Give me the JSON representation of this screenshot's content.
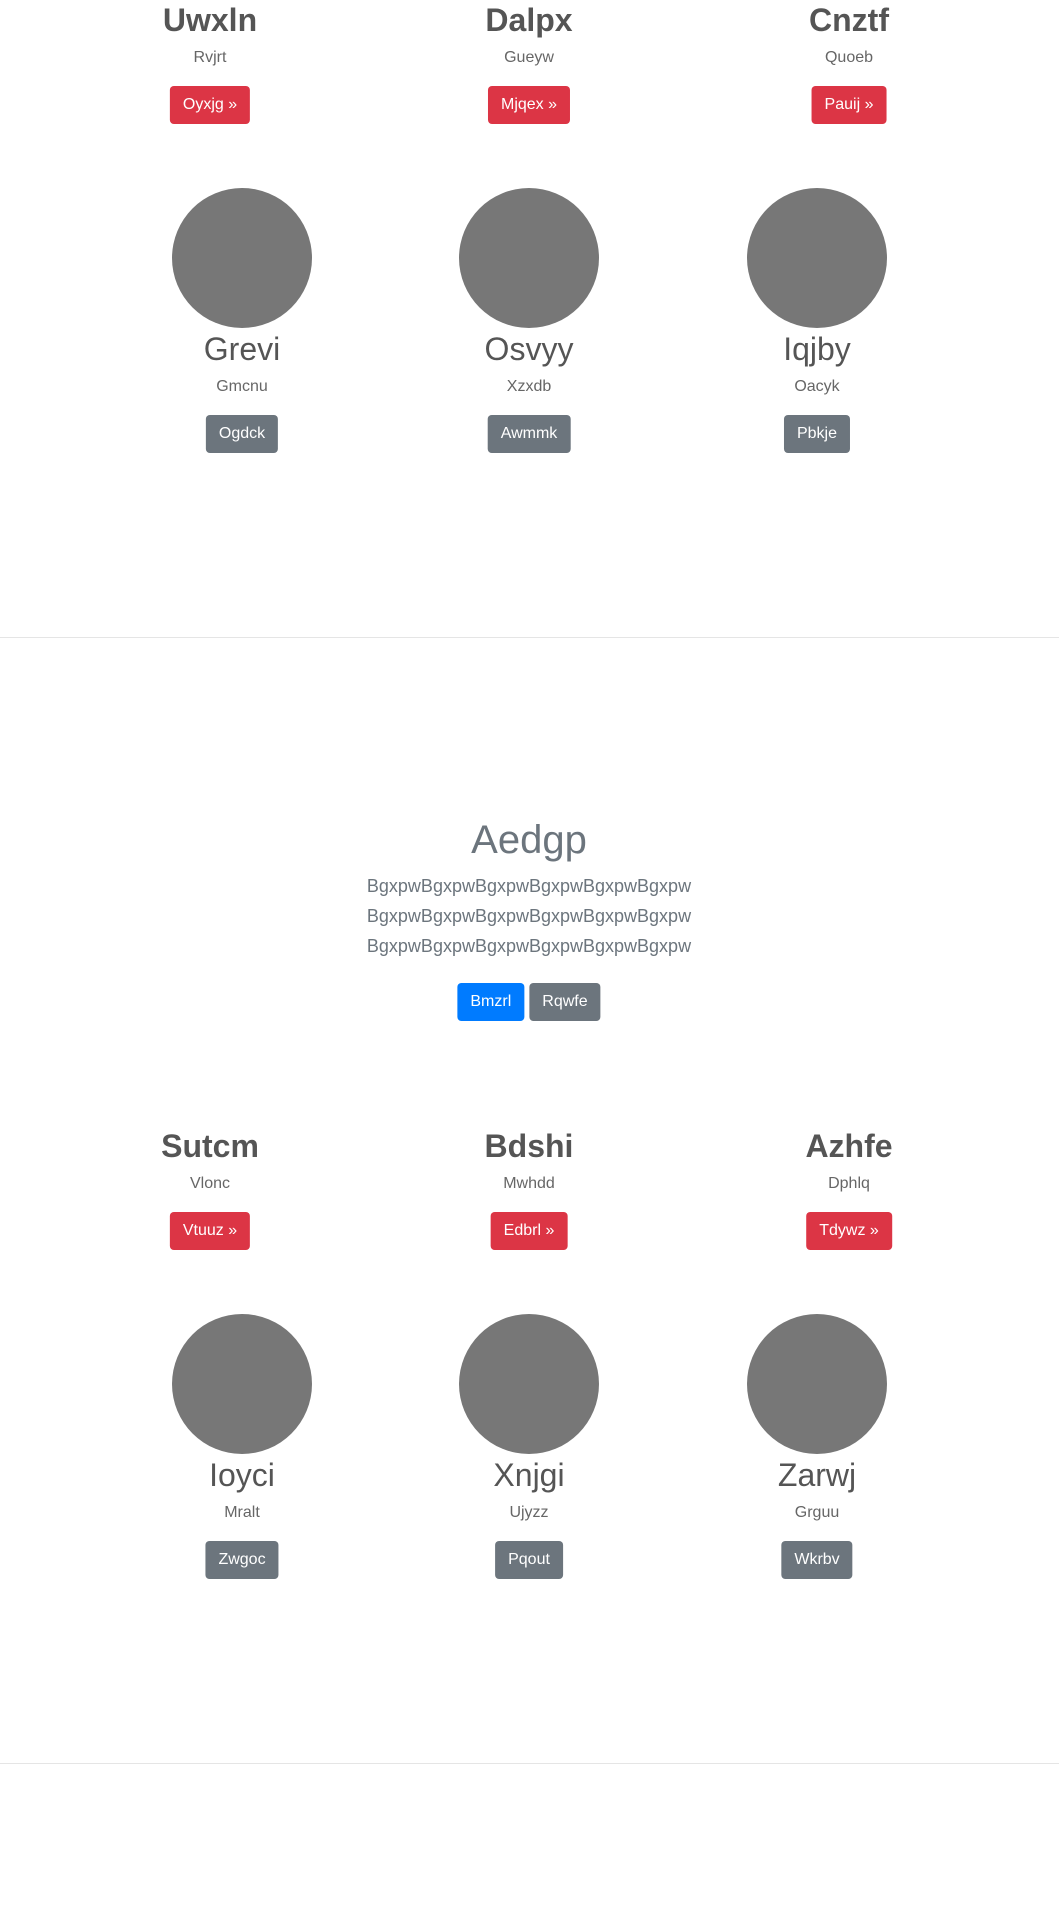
{
  "section1": {
    "features": [
      {
        "heading": "Uwxln",
        "sub": "Rvjrt",
        "button": "Oyxjg »"
      },
      {
        "heading": "Dalpx",
        "sub": "Gueyw",
        "button": "Mjqex »"
      },
      {
        "heading": "Cnztf",
        "sub": "Quoeb",
        "button": "Pauij »"
      }
    ],
    "people": [
      {
        "name": "Grevi",
        "sub": "Gmcnu",
        "button": "Ogdck"
      },
      {
        "name": "Osvyy",
        "sub": "Xzxdb",
        "button": "Awmmk"
      },
      {
        "name": "Iqjby",
        "sub": "Oacyk",
        "button": "Pbkje"
      }
    ]
  },
  "hero": {
    "title": "Aedgp",
    "text": "BgxpwBgxpwBgxpwBgxpwBgxpwBgxpw BgxpwBgxpwBgxpwBgxpwBgxpwBgxpw BgxpwBgxpwBgxpwBgxpwBgxpwBgxpw",
    "primary_button": "Bmzrl",
    "secondary_button": "Rqwfe"
  },
  "section2": {
    "features": [
      {
        "heading": "Sutcm",
        "sub": "Vlonc",
        "button": "Vtuuz »"
      },
      {
        "heading": "Bdshi",
        "sub": "Mwhdd",
        "button": "Edbrl »"
      },
      {
        "heading": "Azhfe",
        "sub": "Dphlq",
        "button": "Tdywz »"
      }
    ],
    "people": [
      {
        "name": "Ioyci",
        "sub": "Mralt",
        "button": "Zwgoc"
      },
      {
        "name": "Xnjgi",
        "sub": "Ujyzz",
        "button": "Pqout"
      },
      {
        "name": "Zarwj",
        "sub": "Grguu",
        "button": "Wkrbv"
      }
    ]
  },
  "colors": {
    "danger": "#dc3545",
    "secondary": "#6c757d",
    "primary": "#007bff",
    "avatar": "#777777"
  }
}
